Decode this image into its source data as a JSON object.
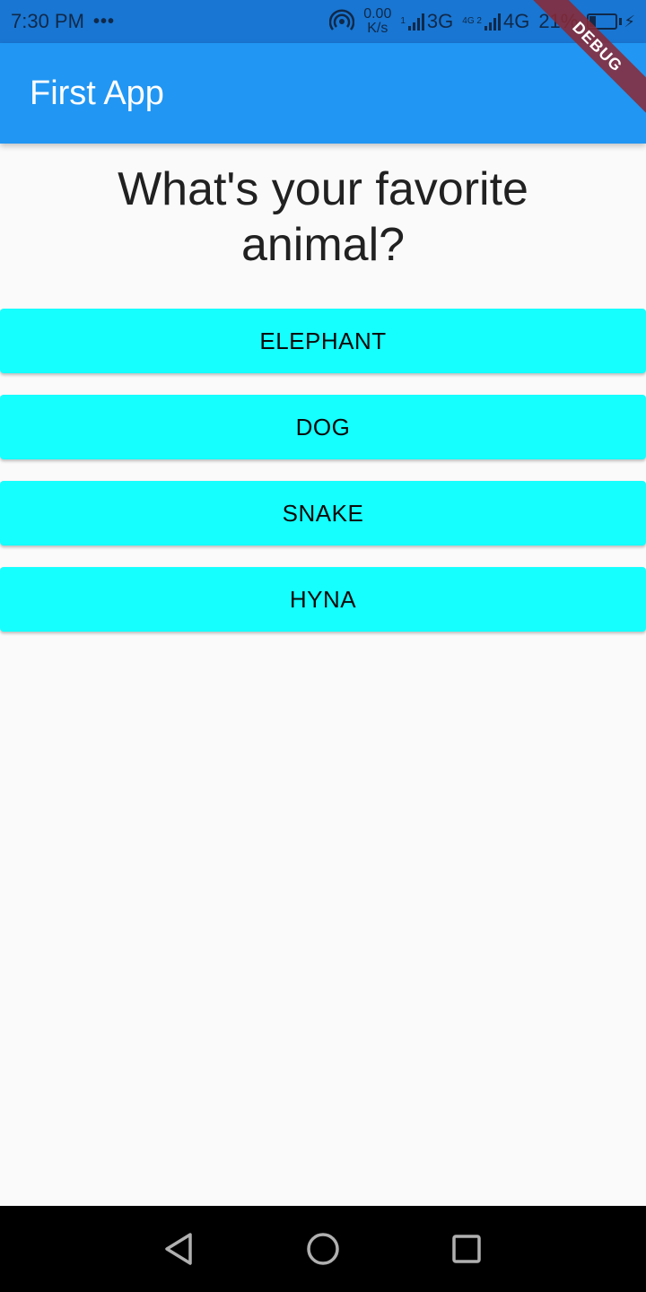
{
  "status_bar": {
    "time": "7:30 PM",
    "dots": "•••",
    "net_speed_value": "0.00",
    "net_speed_unit": "K/s",
    "sim1_tag": "1",
    "sim1_type": "3G",
    "sim2_tag": "4G 2",
    "sim2_type": "4G",
    "battery": "21%"
  },
  "debug_banner": "DEBUG",
  "app_bar": {
    "title": "First App"
  },
  "question": "What's your favorite animal?",
  "answers": [
    {
      "label": "ELEPHANT"
    },
    {
      "label": "DOG"
    },
    {
      "label": "SNAKE"
    },
    {
      "label": "HYNA"
    }
  ],
  "colors": {
    "app_bar": "#2196f3",
    "status_bar": "#1976d2",
    "answer_button": "#15ffff",
    "background": "#fafafa"
  },
  "icons": {
    "hotspot": "hotspot-icon",
    "nav_back": "back-triangle-icon",
    "nav_home": "home-circle-icon",
    "nav_recents": "recents-square-icon"
  }
}
